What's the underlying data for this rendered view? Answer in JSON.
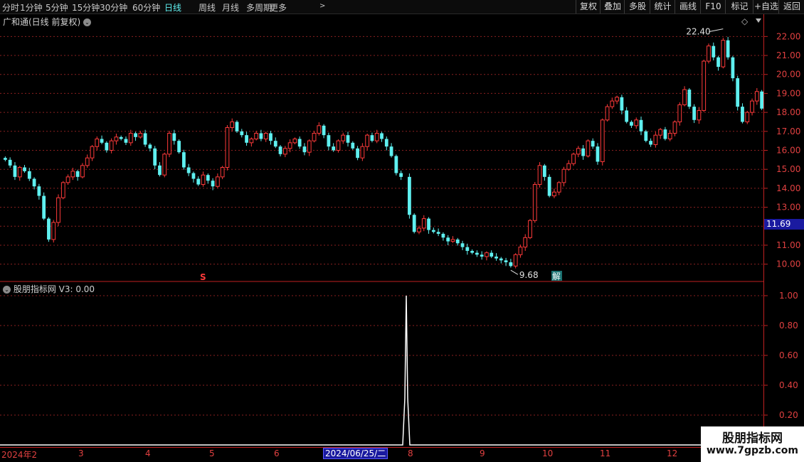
{
  "toolbar": {
    "periods": [
      "分时",
      "1分钟",
      "5分钟",
      "15分钟",
      "30分钟",
      "60分钟",
      "日线",
      "周线",
      "月线",
      "多周期",
      "更多"
    ],
    "active_period": "日线",
    "more_caret": ">",
    "right_buttons": [
      "复权",
      "叠加",
      "多股",
      "统计",
      "画线",
      "F10",
      "标记",
      "+自选",
      "返回"
    ]
  },
  "main_panel": {
    "title": "广和通(日线 前复权)",
    "high_label": "22.40",
    "low_label": "9.68",
    "current_price": "11.69",
    "marker_s": "S",
    "marker_jie": "解",
    "diamond": "◇",
    "y_ticks": [
      "22.00",
      "21.00",
      "20.00",
      "19.00",
      "18.00",
      "17.00",
      "16.00",
      "15.00",
      "14.00",
      "13.00",
      "12.00",
      "11.00",
      "10.00"
    ]
  },
  "indicator_panel": {
    "title": "股朋指标网 V3: 0.00",
    "y_ticks": [
      "1.00",
      "0.80",
      "0.60",
      "0.40",
      "0.20"
    ]
  },
  "date_axis": {
    "labels": [
      "2024年2",
      "3",
      "4",
      "5",
      "6",
      "7",
      "8",
      "9",
      "10",
      "11",
      "12"
    ],
    "highlight": "2024/06/25/二"
  },
  "watermark": {
    "line1": "股朋指标网",
    "line2": "www.7gpzb.com"
  },
  "colors": {
    "up": "#ff3a3a",
    "down": "#5ff0f0",
    "grid": "#8a2020",
    "axis": "#c02020",
    "highlight": "#1a1aa0"
  },
  "chart_data": {
    "type": "candlestick",
    "unit": "price (CNY)",
    "ylim": [
      9.5,
      22.5
    ],
    "high": 22.4,
    "low": 9.68,
    "current": 11.69,
    "closes": [
      15.5,
      15.2,
      14.6,
      15.1,
      14.9,
      14.5,
      14.1,
      13.6,
      12.4,
      11.3,
      12.2,
      13.5,
      14.3,
      14.6,
      14.9,
      14.6,
      15.2,
      15.6,
      16.2,
      16.6,
      16.4,
      16.0,
      16.5,
      16.7,
      16.6,
      16.4,
      16.9,
      16.7,
      16.9,
      16.3,
      16.1,
      15.2,
      14.7,
      15.8,
      16.9,
      16.5,
      15.9,
      15.1,
      14.8,
      14.5,
      14.2,
      14.7,
      14.4,
      14.1,
      14.6,
      15.1,
      17.2,
      17.5,
      17.0,
      16.8,
      16.4,
      16.6,
      16.9,
      16.6,
      16.9,
      16.5,
      16.2,
      15.8,
      16.1,
      16.4,
      16.6,
      16.2,
      15.9,
      16.5,
      16.9,
      17.3,
      16.8,
      16.2,
      16.0,
      16.5,
      16.8,
      16.4,
      16.1,
      15.6,
      16.2,
      16.8,
      16.5,
      16.9,
      16.6,
      16.2,
      15.7,
      14.8,
      14.6,
      12.6,
      11.7,
      11.9,
      12.4,
      11.8,
      11.7,
      11.6,
      11.4,
      11.2,
      11.3,
      11.1,
      10.9,
      10.7,
      10.6,
      10.5,
      10.4,
      10.6,
      10.4,
      10.3,
      10.2,
      10.1,
      9.9,
      10.5,
      10.9,
      11.4,
      12.3,
      14.2,
      15.2,
      14.6,
      13.6,
      13.8,
      14.3,
      15.0,
      15.3,
      15.8,
      16.1,
      15.7,
      16.5,
      16.2,
      15.4,
      17.6,
      18.3,
      18.6,
      18.8,
      18.1,
      17.5,
      17.3,
      17.6,
      17.0,
      16.5,
      16.3,
      16.8,
      17.1,
      16.6,
      16.9,
      17.5,
      18.4,
      19.2,
      18.3,
      17.6,
      18.1,
      20.7,
      21.5,
      20.9,
      20.4,
      21.8,
      20.9,
      19.8,
      18.3,
      17.5,
      18.0,
      18.6,
      19.1,
      18.2
    ]
  }
}
